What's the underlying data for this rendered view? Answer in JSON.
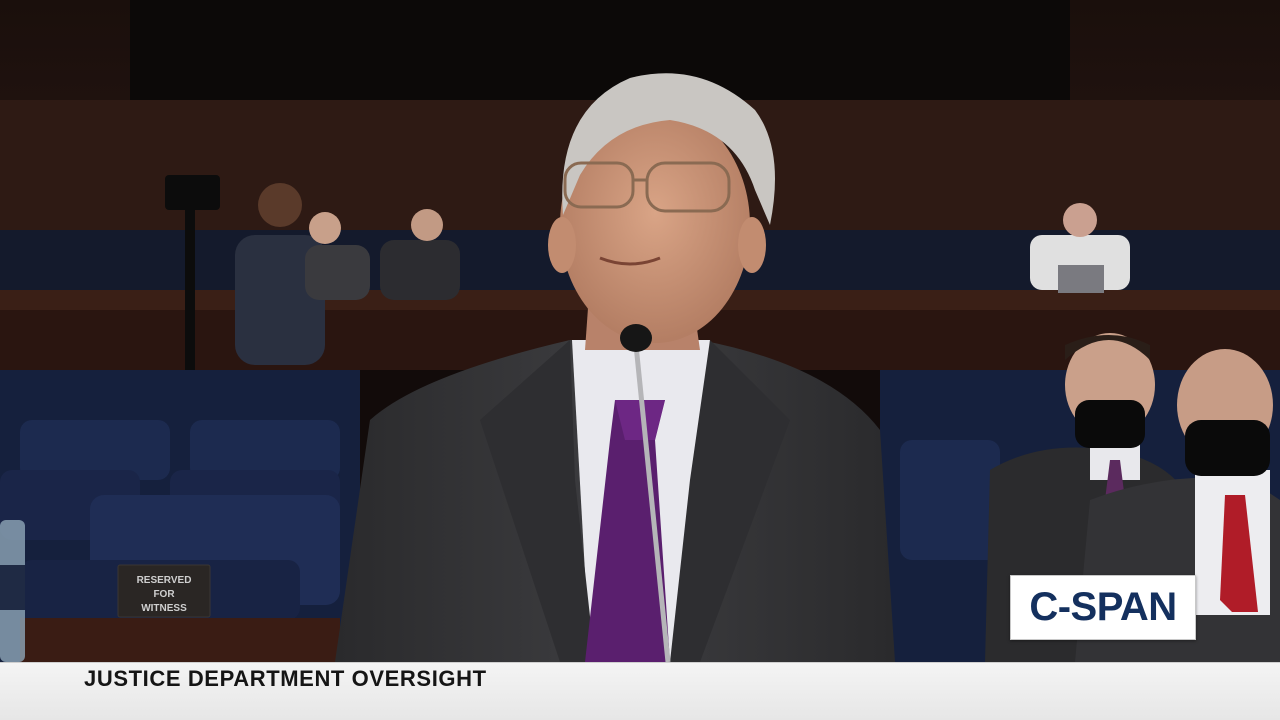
{
  "broadcast": {
    "caption": "JUSTICE DEPARTMENT OVERSIGHT",
    "network_logo": "C-SPAN",
    "logo_color": "#14305e",
    "lower_third_background": "#efefef"
  },
  "scene": {
    "placard_line1": "RESERVED",
    "placard_line2": "FOR",
    "placard_line3": "WITNESS",
    "tie_color": "#5a1f6e",
    "suit_color": "#38383a",
    "seat_color": "#1c2a4f"
  }
}
